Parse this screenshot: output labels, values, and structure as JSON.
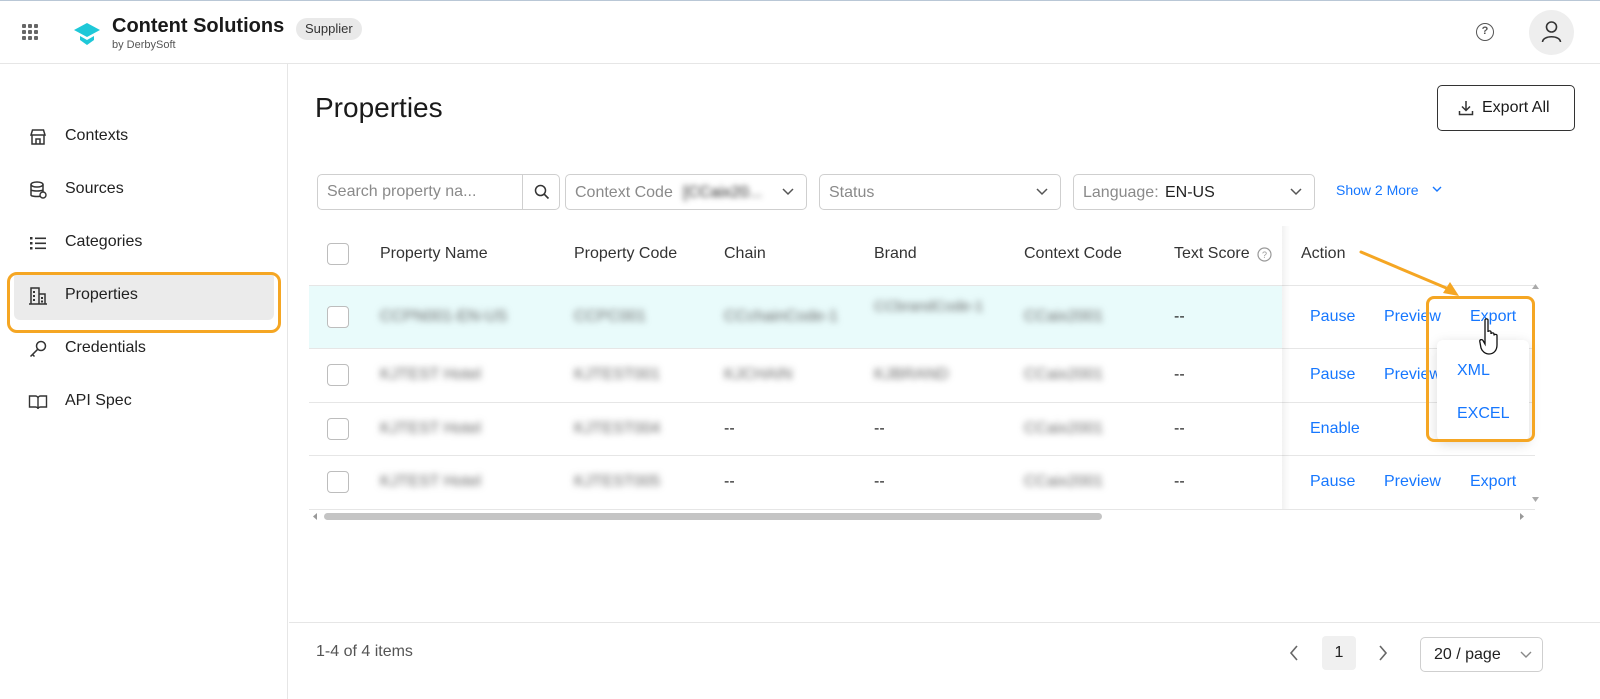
{
  "header": {
    "brand_title": "Content Solutions",
    "brand_sub": "by DerbySoft",
    "tag": "Supplier",
    "help_glyph": "?"
  },
  "sidebar": {
    "items": [
      {
        "label": "Contexts",
        "icon": "store-icon"
      },
      {
        "label": "Sources",
        "icon": "database-icon"
      },
      {
        "label": "Categories",
        "icon": "list-icon"
      },
      {
        "label": "Properties",
        "icon": "building-icon",
        "active": true
      },
      {
        "label": "Credentials",
        "icon": "key-icon"
      },
      {
        "label": "API Spec",
        "icon": "book-icon"
      }
    ]
  },
  "main": {
    "title": "Properties",
    "export_all": "Export All",
    "filters": {
      "search_placeholder": "Search property na...",
      "context_label": "Context Code",
      "context_value": "[CCaix20...",
      "status_label": "Status",
      "language_label": "Language:",
      "language_value": "EN-US",
      "show_more": "Show 2 More"
    },
    "table": {
      "headers": [
        "Property Name",
        "Property Code",
        "Chain",
        "Brand",
        "Context Code",
        "Text Score",
        "Action"
      ],
      "rows": [
        {
          "name": "CCPN001-EN-US",
          "code": "CCPC001",
          "chain": "CCchainCode-1",
          "brand": "CCbrandCode-1",
          "context": "CCaix2001",
          "score": "--",
          "actions": [
            "Pause",
            "Preview",
            "Export"
          ]
        },
        {
          "name": "KJTEST Hotel",
          "code": "KJTEST001",
          "chain": "KJCHAIN",
          "brand": "KJBRAND",
          "context": "CCaix2001",
          "score": "--",
          "actions": [
            "Pause",
            "Preview",
            ""
          ]
        },
        {
          "name": "KJTEST Hotel",
          "code": "KJTEST004",
          "chain": "--",
          "brand": "--",
          "context": "CCaix2001",
          "score": "--",
          "actions": [
            "Enable",
            "",
            ""
          ]
        },
        {
          "name": "KJTEST Hotel",
          "code": "KJTEST005",
          "chain": "--",
          "brand": "--",
          "context": "CCaix2001",
          "score": "--",
          "actions": [
            "Pause",
            "Preview",
            "Export"
          ]
        }
      ]
    },
    "export_menu": [
      "XML",
      "EXCEL"
    ]
  },
  "footer": {
    "range": "1-4 of 4 items",
    "current_page": "1",
    "page_size": "20 / page"
  },
  "colors": {
    "accent": "#1677ff",
    "highlight": "#f5a623"
  }
}
